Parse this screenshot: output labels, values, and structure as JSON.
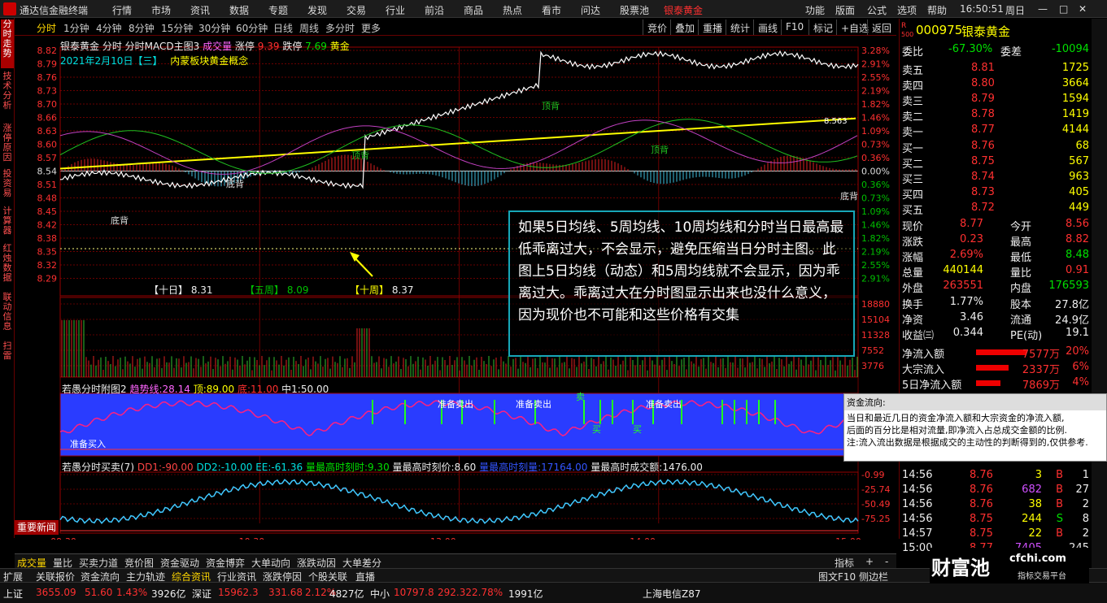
{
  "menubar": {
    "app_title": "通达信金融终端",
    "items": [
      "行情",
      "市场",
      "资讯",
      "数据",
      "专题",
      "发现",
      "交易",
      "行业",
      "前沿",
      "商品",
      "热点",
      "看市",
      "问达",
      "股票池"
    ],
    "highlight_item": "银泰黄金",
    "right_items": [
      "功能",
      "版面",
      "公式",
      "选项",
      "帮助"
    ],
    "clock": "16:50:51",
    "weekday": "周日"
  },
  "sidebar": {
    "tabs": [
      "分时走势",
      "技术分析",
      "涨停原因",
      "投资易",
      "计算器",
      "红烛数据",
      "联动信息",
      "扫雷"
    ]
  },
  "toolbar": {
    "periods": [
      "分时",
      "1分钟",
      "4分钟",
      "8分钟",
      "15分钟",
      "30分钟",
      "60分钟",
      "日线",
      "周线",
      "多分时",
      "更多"
    ],
    "buttons": [
      "竞价",
      "叠加",
      "重播",
      "统计",
      "画线",
      "F10",
      "标记",
      "+自选",
      "返回"
    ]
  },
  "chart": {
    "header_left": "银泰黄金 分时 分时MACD主图3",
    "header_vol": "成交量",
    "header_up_label": "涨停",
    "header_up": "9.39",
    "header_down_label": "跌停",
    "header_down": "7.69",
    "header_gold": "黄金",
    "date_line": "2021年2月10日【三】",
    "concept": "内蒙板块黄金概念",
    "price_ticks": [
      "8.82",
      "8.79",
      "8.76",
      "8.73",
      "8.70",
      "8.66",
      "8.63",
      "8.60",
      "8.57",
      "8.54",
      "8.51",
      "8.48",
      "8.45",
      "8.42",
      "8.38",
      "8.35",
      "8.32",
      "8.29"
    ],
    "pct_ticks": [
      "3.28%",
      "2.91%",
      "2.55%",
      "2.19%",
      "1.82%",
      "1.46%",
      "1.09%",
      "0.73%",
      "0.36%",
      "0.00%",
      "0.36%",
      "0.73%",
      "1.09%",
      "1.46%",
      "1.82%",
      "2.19%",
      "2.55%",
      "2.91%"
    ],
    "ma_label_10d": "【十日】",
    "ma_value_10d": "8.31",
    "ma_label_5w": "【五周】",
    "ma_value_5w": "8.09",
    "ma_label_10w": "【十周】",
    "ma_value_10w": "8.37",
    "note_8563": "8.563",
    "labels": {
      "dibei": "底背",
      "dingbei": "顶背"
    },
    "vol_ticks": [
      "18880",
      "15104",
      "11328",
      "7552",
      "3776"
    ],
    "annotation": "如果5日均线、5周均线、10周均线和分时当日最高最低乖离过大，不会显示，避免压缩当日分时主图。此图上5日均线（动态）和5周均线就不会显示，因为乖离过大。乖离过大在分时图显示出来也没什么意义，因为现价也不可能和这些价格有交集",
    "sub1": {
      "title": "若愚分时附图2",
      "trend_label": "趋势线:",
      "trend": "28.14",
      "top_label": "顶:",
      "top": "89.00",
      "bot_label": "底:",
      "bot": "11.00",
      "mid_label": "中1:",
      "mid": "50.00",
      "buy": "准备买入",
      "sell": "准备卖出",
      "sell_short": "卖",
      "buy_short": "买"
    },
    "sub2": {
      "title": "若愚分时买卖(7)",
      "dd1_label": "DD1:",
      "dd1": "-90.00",
      "dd2_label": "DD2:",
      "dd2": "-10.00",
      "ee_label": "EE:",
      "ee": "-61.36",
      "maxtime_label": "量最高时刻时:",
      "maxtime": "9.30",
      "maxprice_label": "量最高时刻价:",
      "maxprice": "8.60",
      "maxmin_label": "量最高时刻量:",
      "maxmin": "17164.00",
      "maxvol_label": "量最高时成交额:",
      "maxvol": "1476.00",
      "ticks": [
        "-0.99",
        "-25.74",
        "-50.49",
        "-75.25"
      ]
    },
    "time_ticks": [
      "09:30",
      "10:30",
      "13:00",
      "14:00",
      "15:00"
    ]
  },
  "news_button": "重要新闻",
  "bottom_tabs": [
    "成交量",
    "量比",
    "买卖力道",
    "竞价图",
    "资金驱动",
    "资金博弈",
    "大单动向",
    "涨跌动因",
    "大单差分"
  ],
  "bottom_right": [
    "指标",
    "+",
    "-"
  ],
  "funcbar": {
    "tabs": [
      "扩展",
      "关联报价",
      "资金流向",
      "主力轨迹",
      "综合资讯",
      "行业资讯",
      "涨跌停因",
      "个股关联",
      "直播"
    ],
    "active": "综合资讯",
    "right": [
      "图文F10",
      "侧边栏"
    ]
  },
  "quote": {
    "code": "000975",
    "name": "银泰黄金",
    "badge": "R",
    "badge2": "500",
    "weibi_label": "委比",
    "weibi": "-67.30%",
    "weicha_label": "委差",
    "weicha": "-10094",
    "asks": [
      {
        "label": "卖五",
        "price": "8.81",
        "vol": "1725"
      },
      {
        "label": "卖四",
        "price": "8.80",
        "vol": "3664"
      },
      {
        "label": "卖三",
        "price": "8.79",
        "vol": "1594"
      },
      {
        "label": "卖二",
        "price": "8.78",
        "vol": "1419"
      },
      {
        "label": "卖一",
        "price": "8.77",
        "vol": "4144"
      }
    ],
    "bids": [
      {
        "label": "买一",
        "price": "8.76",
        "vol": "68"
      },
      {
        "label": "买二",
        "price": "8.75",
        "vol": "567"
      },
      {
        "label": "买三",
        "price": "8.74",
        "vol": "963"
      },
      {
        "label": "买四",
        "price": "8.73",
        "vol": "405"
      },
      {
        "label": "买五",
        "price": "8.72",
        "vol": "449"
      }
    ],
    "stats": [
      {
        "l1": "现价",
        "v1": "8.77",
        "l2": "今开",
        "v2": "8.56"
      },
      {
        "l1": "涨跌",
        "v1": "0.23",
        "l2": "最高",
        "v2": "8.82"
      },
      {
        "l1": "涨幅",
        "v1": "2.69%",
        "l2": "最低",
        "v2": "8.48"
      },
      {
        "l1": "总量",
        "v1": "440144",
        "l2": "量比",
        "v2": "0.91"
      },
      {
        "l1": "外盘",
        "v1": "263551",
        "l2": "内盘",
        "v2": "176593"
      }
    ],
    "stats2": [
      {
        "l1": "换手",
        "v1": "1.77%",
        "l2": "股本",
        "v2": "27.8亿"
      },
      {
        "l1": "净资",
        "v1": "3.46",
        "l2": "流通",
        "v2": "24.9亿"
      },
      {
        "l1": "收益㈢",
        "v1": "0.344",
        "l2": "PE(动)",
        "v2": "19.1"
      }
    ],
    "flows": [
      {
        "label": "净流入额",
        "value": "7577万",
        "pct": "20%"
      },
      {
        "label": "大宗流入",
        "value": "2337万",
        "pct": "6%"
      },
      {
        "label": "5日净流入额",
        "value": "7869万",
        "pct": "4%"
      }
    ],
    "trades": [
      {
        "time": "14:56",
        "price": "8.76",
        "vol": "3",
        "side": "B",
        "n": "1"
      },
      {
        "time": "14:56",
        "price": "8.76",
        "vol": "682",
        "side": "B",
        "n": "27"
      },
      {
        "time": "14:56",
        "price": "8.76",
        "vol": "38",
        "side": "B",
        "n": "2"
      },
      {
        "time": "14:56",
        "price": "8.75",
        "vol": "244",
        "side": "S",
        "n": "8"
      },
      {
        "time": "14:57",
        "price": "8.75",
        "vol": "22",
        "side": "B",
        "n": "2"
      },
      {
        "time": "15:00",
        "price": "8.77",
        "vol": "7405",
        "side": "",
        "n": "245"
      }
    ]
  },
  "tooltip": {
    "title": "资金流向:",
    "lines": [
      "当日和最近几日的资金净流入额和大宗资金的净流入额,",
      "后面的百分比是相对流量,即净流入占总成交金额的比例.",
      "注:流入流出数据是根据成交的主动性的判断得到的,仅供参考."
    ]
  },
  "status": {
    "sh_label": "上证",
    "sh": "3655.09",
    "sh_chg": "51.60",
    "sh_pct": "1.43%",
    "sh_amt": "3926亿",
    "sz_label": "深证",
    "sz": "15962.3",
    "sz_chg": "331.68",
    "sz_pct": "2.12%",
    "sz_amt": "4827亿",
    "zx_label": "中小",
    "zx": "10797.8",
    "zx_chg": "292.32",
    "zx_pct": "2.78%",
    "zx_amt": "1991亿",
    "server": "上海电信Z87"
  },
  "watermark": {
    "brand": "财富池",
    "site": "cfchi.com",
    "slogan": "指标交易平台"
  },
  "colors": {
    "accent": "#ff3030",
    "up": "#ff3030",
    "down": "#00e000",
    "ma_yellow": "#ffff00",
    "annotation_border": "#17a7b8",
    "sub1_bg": "#2a3cff"
  }
}
